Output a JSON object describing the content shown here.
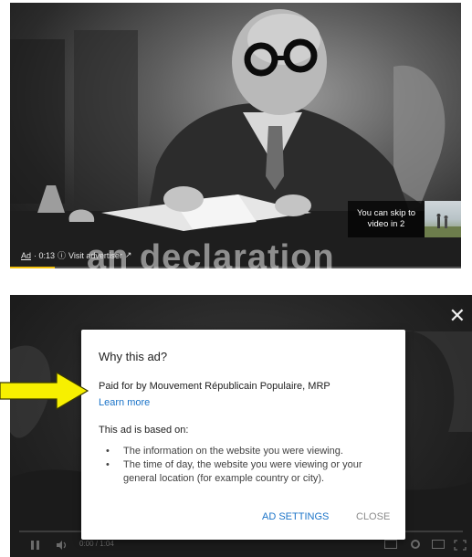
{
  "top_player": {
    "overlay_word": "an declaration",
    "ad_label": "Ad",
    "ad_time": "· 0:13",
    "info_icon": "info-icon",
    "visit_advertiser": "Visit advertiser",
    "external_icon": "external-link-icon",
    "skip_text": "You can skip to video in 2",
    "progress": 0.1,
    "progress_color": "#f4c20d"
  },
  "bottom_player": {
    "close_icon": "close-icon",
    "time": "0:00 / 1:04",
    "dialog": {
      "title": "Why this ad?",
      "paid_for": "Paid for by Mouvement Républicain Populaire, MRP",
      "learn_more": "Learn more",
      "based_on": "This ad is based on:",
      "reasons": [
        "The information on the website you were viewing.",
        "The time of day, the website you were viewing or your general location (for example country or city)."
      ],
      "ad_settings": "AD SETTINGS",
      "close": "CLOSE"
    }
  },
  "colors": {
    "link": "#1a73c8",
    "arrow": "#f7f000"
  }
}
